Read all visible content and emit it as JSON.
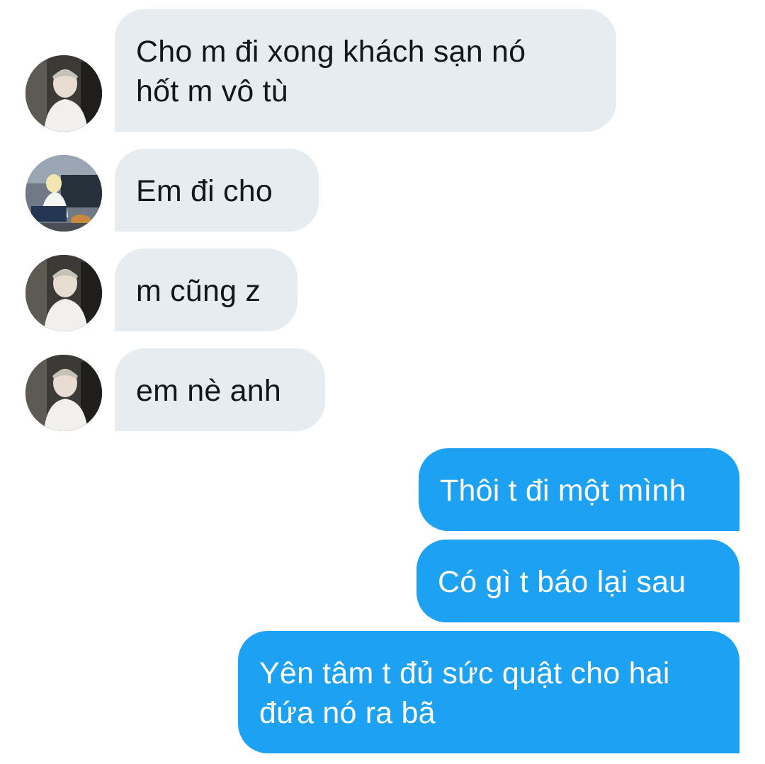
{
  "conversation": {
    "messages": [
      {
        "direction": "incoming",
        "sender_avatar": "avatar-white-shirt-cap",
        "text": "Cho m đi xong khách sạn nó\nhốt m vô tù"
      },
      {
        "direction": "incoming",
        "sender_avatar": "avatar-crouching-with-dog",
        "text": "Em đi cho"
      },
      {
        "direction": "incoming",
        "sender_avatar": "avatar-white-shirt-cap",
        "text": "m cũng z"
      },
      {
        "direction": "incoming",
        "sender_avatar": "avatar-white-shirt-cap",
        "text": "em nè anh"
      },
      {
        "direction": "outgoing",
        "text": "Thôi t đi một mình"
      },
      {
        "direction": "outgoing",
        "text": "Có gì t báo lại sau"
      },
      {
        "direction": "outgoing",
        "text": "Yên tâm t đủ sức quật cho hai\nđứa nó ra bã"
      }
    ]
  },
  "colors": {
    "incoming_bubble": "#e6ecf0",
    "incoming_text": "#14171a",
    "outgoing_bubble": "#1da1f2",
    "outgoing_text": "#ffffff"
  }
}
